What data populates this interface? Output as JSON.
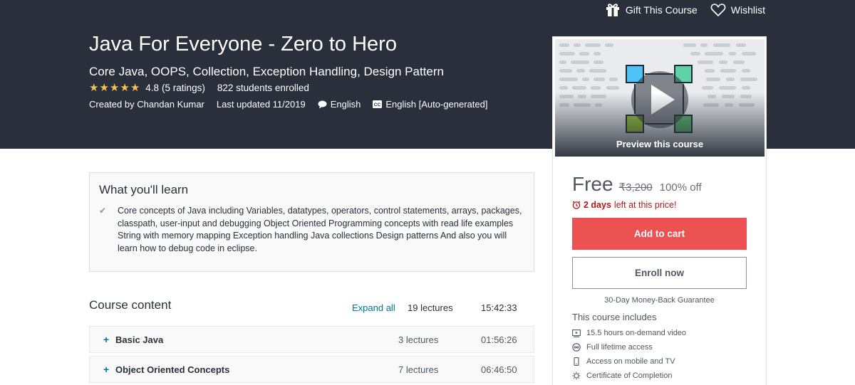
{
  "topbar": {
    "gift_label": "Gift This Course",
    "wishlist_label": "Wishlist"
  },
  "course": {
    "title": "Java For Everyone - Zero to Hero",
    "subtitle": "Core Java, OOPS, Collection, Exception Handling, Design Pattern",
    "rating_value": 4.8,
    "rating": "4.8",
    "ratings_count": "(5 ratings)",
    "students": "822 students enrolled",
    "created_by": "Created by Chandan Kumar",
    "last_updated": "Last updated 11/2019",
    "language": "English",
    "captions": "English [Auto-generated]"
  },
  "sidebar": {
    "preview_label": "Preview this course",
    "price": "Free",
    "original_price": "₹3,200",
    "discount": "100% off",
    "deadline_bold": "2 days",
    "deadline_rest": "left at this price!",
    "add_to_cart": "Add to cart",
    "enroll_now": "Enroll now",
    "guarantee": "30-Day Money-Back Guarantee",
    "includes_title": "This course includes",
    "includes": [
      {
        "icon": "video-icon",
        "label": "15.5 hours on-demand video"
      },
      {
        "icon": "infinity-icon",
        "label": "Full lifetime access"
      },
      {
        "icon": "mobile-tv-icon",
        "label": "Access on mobile and TV"
      },
      {
        "icon": "certificate-icon",
        "label": "Certificate of Completion"
      }
    ]
  },
  "learn": {
    "title": "What you'll learn",
    "items": [
      "Core concepts of Java including Variables, datatypes, operators, control statements, arrays, packages, classpath, user-input and debugging Object Oriented Programming concepts with read life examples String with memory mapping Exception handling Java collections Design patterns And also you will learn how to debug code in eclipse."
    ]
  },
  "content": {
    "title": "Course content",
    "expand_all": "Expand all",
    "lectures": "19 lectures",
    "duration": "15:42:33",
    "sections": [
      {
        "name": "Basic Java",
        "lectures": "3 lectures",
        "duration": "01:56:26"
      },
      {
        "name": "Object Oriented Concepts",
        "lectures": "7 lectures",
        "duration": "06:46:50"
      }
    ]
  },
  "colors": {
    "header_bg": "#29303b",
    "accent_red": "#ec5252",
    "link_teal": "#007791",
    "star_gold": "#f4c150",
    "deadline_red": "#ae1a1a"
  }
}
